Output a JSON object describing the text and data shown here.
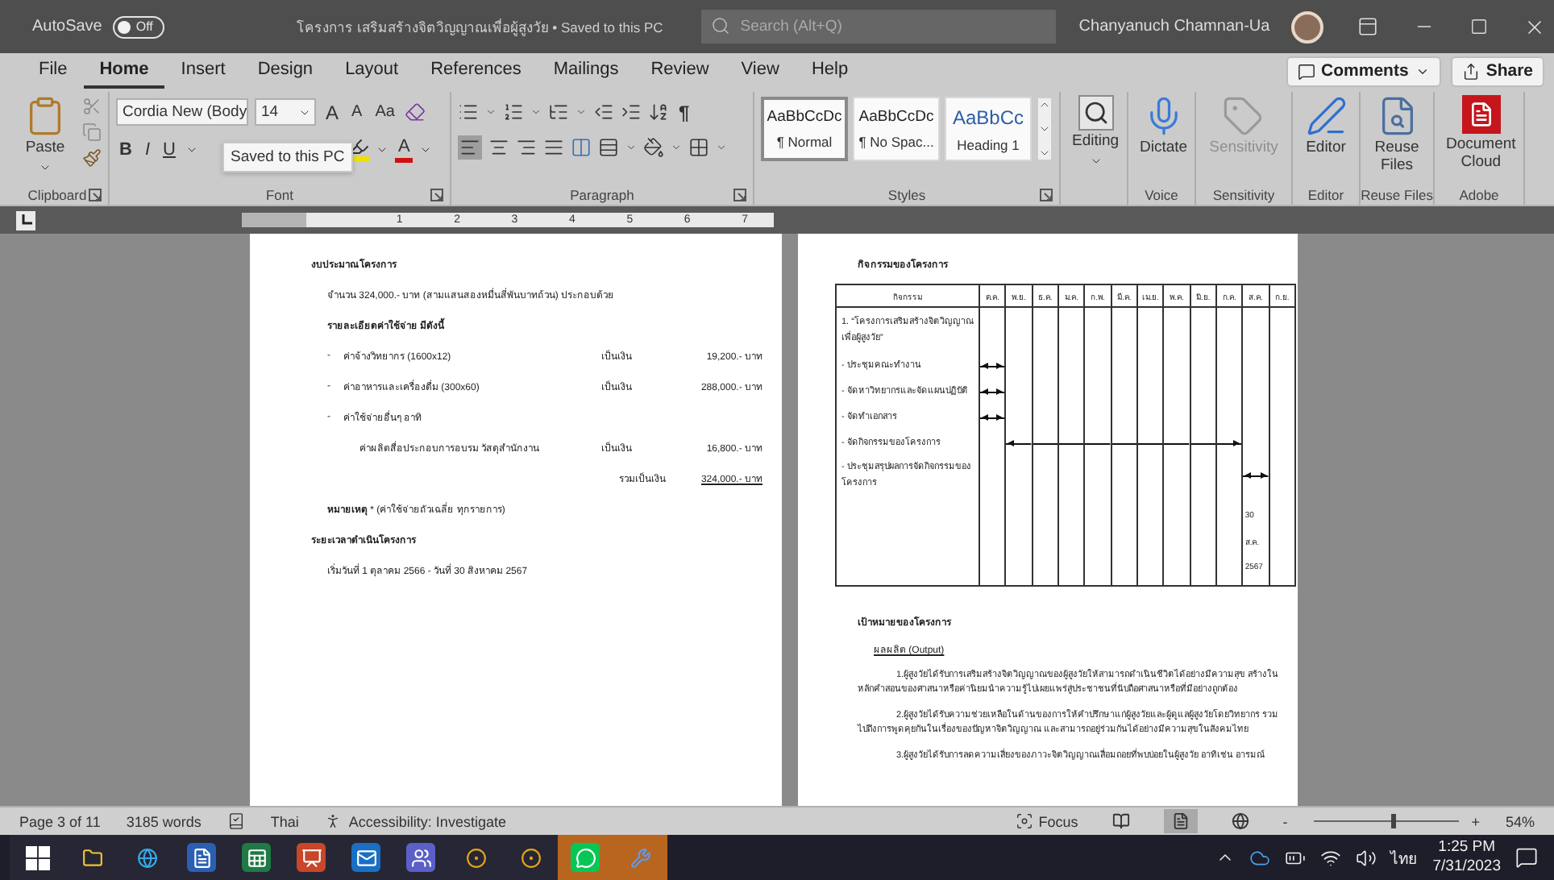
{
  "title_bar": {
    "autosave_label": "AutoSave",
    "autosave": {
      "label": "Off",
      "on": false
    },
    "title": "โครงการ เสริมสร้างจิตวิญญาณเพื่อผู้สูงวัย • Saved to this PC",
    "search": {
      "placeholder": "Search (Alt+Q)"
    },
    "user": "Chanyanuch Chamnan-Ua"
  },
  "menu_tabs": [
    {
      "label": "File",
      "selected": false
    },
    {
      "label": "Home",
      "selected": true
    },
    {
      "label": "Insert",
      "selected": false
    },
    {
      "label": "Design",
      "selected": false
    },
    {
      "label": "Layout",
      "selected": false
    },
    {
      "label": "References",
      "selected": false
    },
    {
      "label": "Mailings",
      "selected": false
    },
    {
      "label": "Review",
      "selected": false
    },
    {
      "label": "View",
      "selected": false
    },
    {
      "label": "Help",
      "selected": false
    }
  ],
  "comments": "Comments",
  "share": "Share",
  "ribbon": {
    "clipboard": {
      "paste": "Paste",
      "label": "Clipboard"
    },
    "font": {
      "name": "Cordia New (Body",
      "size": "14",
      "grow": "A",
      "shrink": "A",
      "case": "Aa",
      "styles": [
        "B",
        "I",
        "U"
      ],
      "color_letter": "A",
      "label": "Font"
    },
    "tooltip": "Saved to this PC",
    "paragraph": {
      "pilcrow": "¶",
      "label": "Paragraph"
    },
    "styles": {
      "label": "Styles",
      "items": [
        {
          "preview": "AaBbCcDc",
          "name": "¶ Normal",
          "selected": true
        },
        {
          "preview": "AaBbCcDc",
          "name": "¶ No Spac...",
          "selected": false
        },
        {
          "preview": "AaBbCc",
          "name": "Heading 1",
          "selected": false
        }
      ]
    },
    "editing": "Editing",
    "groups": [
      {
        "kind": "dictate",
        "button": "Dictate",
        "label": "Voice",
        "disabled": false
      },
      {
        "kind": "sensitivity",
        "button": "Sensitivity",
        "label": "Sensitivity",
        "disabled": true
      },
      {
        "kind": "editor",
        "button": "Editor",
        "label": "Editor",
        "disabled": false
      },
      {
        "kind": "reuse",
        "button": "Reuse Files",
        "label": "Reuse Files",
        "disabled": false
      },
      {
        "kind": "cloud",
        "button": "Document Cloud",
        "label": "Adobe",
        "disabled": false
      }
    ]
  },
  "ruler": {
    "numbers": [
      "1",
      "2",
      "3",
      "4",
      "5",
      "6",
      "7"
    ]
  },
  "left_page": {
    "blocks": [
      {
        "kind": "heading",
        "text": "งบประมาณโครงการ"
      },
      {
        "kind": "text",
        "text": "จำนวน 324,000.- บาท (สามแสนสองหมื่นสี่พันบาทถ้วน) ประกอบด้วย"
      },
      {
        "kind": "subheading",
        "text": "รายละเอียดค่าใช้จ่าย มีดังนี้"
      },
      {
        "kind": "cost",
        "marker": "-",
        "text": "ค่าจ้างวิทยากร (1600x12)",
        "unit": "เป็นเงิน",
        "amount": "19,200.- บาท"
      },
      {
        "kind": "cost",
        "marker": "-",
        "text": "ค่าอาหารและเครื่องดื่ม (300x60)",
        "unit": "เป็นเงิน",
        "amount": "288,000.- บาท"
      },
      {
        "kind": "cost",
        "marker": "-",
        "text": "ค่าใช้จ่ายอื่นๆ อาทิ"
      },
      {
        "kind": "subcost",
        "text": "ค่าผลิตสื่อประกอบการอบรม วัสดุสำนักงาน",
        "unit": "เป็นเงิน",
        "amount": "16,800.- บาท"
      },
      {
        "kind": "total",
        "unit": "รวมเป็นเงิน",
        "amount": "324,000.- บาท"
      },
      {
        "kind": "note",
        "text": "**หมายเหตุ** * (ค่าใช้จ่ายถัวเฉลี่ย ทุกรายการ)"
      },
      {
        "kind": "heading",
        "text": "ระยะเวลาดำเนินโครงการ"
      },
      {
        "kind": "text",
        "text": "เริ่มวันที่ 1 ตุลาคม 2566 - วันที่ 30 สิงหาคม 2567"
      }
    ]
  },
  "right_page": {
    "title": "กิจกรรมของโครงการ",
    "schedule": {
      "header": "กิจกรรม",
      "months": [
        "ต.ค.",
        "พ.ย.",
        "ธ.ค.",
        "ม.ค.",
        "ก.พ.",
        "มี.ค.",
        "เม.ย.",
        "พ.ค.",
        "มิ.ย.",
        "ก.ค.",
        "ส.ค.",
        "ก.ย."
      ],
      "project": "1. “โครงการเสริมสร้างจิตวิญญาณเพื่อผู้สูงวัย”",
      "activities": [
        {
          "text": "- ประชุมคณะทำงาน",
          "months": [
            true,
            false,
            false,
            false,
            false,
            false,
            false,
            false,
            false,
            false,
            false,
            false
          ]
        },
        {
          "text": "- จัดหาวิทยากรและจัดแผนปฏิบัติ",
          "months": [
            true,
            false,
            false,
            false,
            false,
            false,
            false,
            false,
            false,
            false,
            false,
            false
          ]
        },
        {
          "text": "- จัดทำเอกสาร",
          "months": [
            true,
            false,
            false,
            false,
            false,
            false,
            false,
            false,
            false,
            false,
            false,
            false
          ]
        },
        {
          "text": "- จัดกิจกรรมของโครงการ",
          "months": [
            false,
            true,
            true,
            true,
            true,
            true,
            true,
            true,
            true,
            true,
            false,
            false
          ]
        },
        {
          "text": "- ประชุมสรุปผลการจัดกิจกรรมของโครงการ",
          "months": [
            false,
            false,
            false,
            false,
            false,
            false,
            false,
            false,
            false,
            false,
            true,
            false
          ],
          "note": [
            "30",
            "ส.ค.",
            "2567"
          ]
        }
      ]
    },
    "goals_title": "เป้าหมายของโครงการ",
    "output_title": "ผลผลิต (Output)",
    "goals": [
      "1.ผู้สูงวัยได้รับการเสริมสร้างจิตวิญญาณของผู้สูงวัยให้สามารถดำเนินชีวิตได้อย่างมีความสุข สร้างในหลักคำสอนของศาสนาหรือค่านิยมนำความรู้ไปเผยแพร่สู่ประชาชนที่นับถือศาสนาหรือที่มีอย่างถูกต้อง",
      "2.ผู้สูงวัยได้รับความช่วยเหลือในด้านของการให้คำปรึกษาแก่ผู้สูงวัยและผู้ดูแลผู้สูงวัยโดยวิทยากร รวมไปถึงการพูดคุยกันในเรื่องของปัญหาจิตวิญญาณ และสามารถอยู่ร่วมกันได้อย่างมีความสุขในสังคมไทย",
      "3.ผู้สูงวัยได้รับการลดความเสี่ยงของภาวะจิตวิญญาณเสื่อมถอยที่พบบ่อยในผู้สูงวัย อาทิเช่น อารมณ์"
    ]
  },
  "status_bar": {
    "page": "Page 3 of 11",
    "words": "3185 words",
    "language": "Thai",
    "accessibility": "Accessibility: Investigate",
    "focus": "Focus",
    "views": [
      {
        "kind": "read",
        "selected": false
      },
      {
        "kind": "print",
        "selected": true
      },
      {
        "kind": "web",
        "selected": false
      }
    ],
    "zoom": {
      "minus": "-",
      "plus": "+",
      "level": 0.55,
      "reading": "54%"
    }
  },
  "taskbar": {
    "apps": [
      {
        "kind": "start",
        "attention": false
      },
      {
        "kind": "folder",
        "attention": false
      },
      {
        "kind": "browser",
        "attention": false
      },
      {
        "kind": "document",
        "attention": false
      },
      {
        "kind": "spreadsheet",
        "attention": false
      },
      {
        "kind": "presentation",
        "attention": false
      },
      {
        "kind": "mail",
        "attention": false
      },
      {
        "kind": "meeting",
        "attention": false
      },
      {
        "kind": "chrome",
        "attention": false
      },
      {
        "kind": "chrome",
        "attention": false
      },
      {
        "kind": "chat",
        "attention": true
      },
      {
        "kind": "tool",
        "attention": true
      }
    ],
    "language": "ไทย",
    "time": "1:25 PM",
    "date": "7/31/2023"
  }
}
